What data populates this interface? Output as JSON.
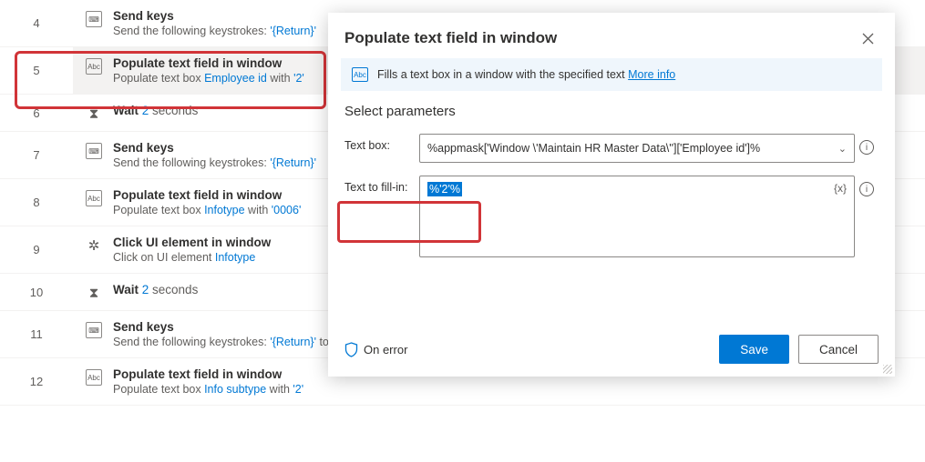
{
  "flow": {
    "steps": [
      {
        "num": "4",
        "icon": "keyboard",
        "title": "Send keys",
        "desc_pre": "Send the following keystrokes: ",
        "desc_link": "'{Return}'",
        "desc_post": ""
      },
      {
        "num": "5",
        "icon": "abc",
        "title": "Populate text field in window",
        "desc_pre": "Populate text box ",
        "desc_link": "Employee id",
        "desc_mid": " with ",
        "desc_link2": "'2'",
        "selected": true
      },
      {
        "num": "6",
        "icon": "hourglass",
        "title": "Wait",
        "desc_link": "2",
        "desc_post": " seconds"
      },
      {
        "num": "7",
        "icon": "keyboard",
        "title": "Send keys",
        "desc_pre": "Send the following keystrokes: ",
        "desc_link": "'{Return}'"
      },
      {
        "num": "8",
        "icon": "abc",
        "title": "Populate text field in window",
        "desc_pre": "Populate text box ",
        "desc_link": "Infotype",
        "desc_mid": " with ",
        "desc_link2": "'0006'"
      },
      {
        "num": "9",
        "icon": "click",
        "title": "Click UI element in window",
        "desc_pre": "Click on UI element ",
        "desc_link": "Infotype"
      },
      {
        "num": "10",
        "icon": "hourglass",
        "title": "Wait",
        "desc_link": "2",
        "desc_post": " seconds"
      },
      {
        "num": "11",
        "icon": "keyboard",
        "title": "Send keys",
        "desc_pre": "Send the following keystrokes: ",
        "desc_link": "'{Return}'",
        "desc_post": " to the active window"
      },
      {
        "num": "12",
        "icon": "abc",
        "title": "Populate text field in window",
        "desc_pre": "Populate text box ",
        "desc_link": "Info subtype",
        "desc_mid": " with ",
        "desc_link2": "'2'"
      }
    ]
  },
  "panel": {
    "title": "Populate text field in window",
    "info_text": "Fills a text box in a window with the specified text ",
    "more_info": "More info",
    "params_title": "Select parameters",
    "textbox_label": "Text box:",
    "textbox_value": "%appmask['Window \\'Maintain HR Master Data\\'']['Employee id']%",
    "fillin_label": "Text to fill-in:",
    "fillin_value": "%'2'%",
    "fx_label": "{x}",
    "on_error": "On error",
    "save": "Save",
    "cancel": "Cancel"
  },
  "icons": {
    "keyboard": "⌨",
    "abc": "Abc",
    "hourglass": "⧗",
    "click": "✲"
  }
}
